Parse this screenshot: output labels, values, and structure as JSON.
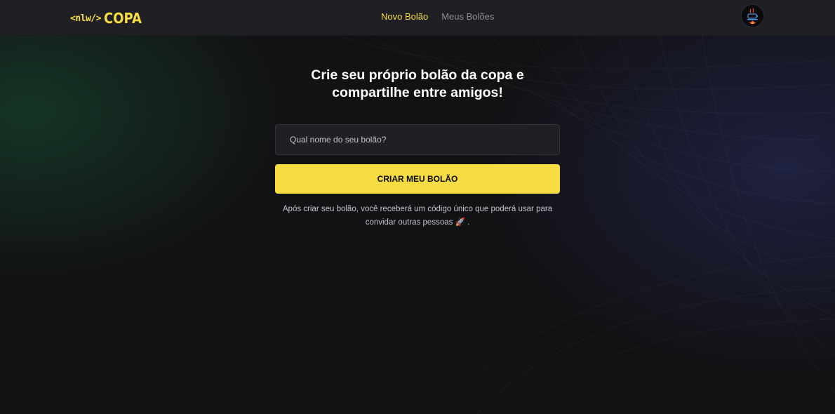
{
  "header": {
    "logo_prefix": "<nlw/>",
    "logo_main": "COPA",
    "nav": [
      {
        "label": "Novo Bolão",
        "active": true
      },
      {
        "label": "Meus Bolões",
        "active": false
      }
    ],
    "avatar_icon": "java-cup-icon"
  },
  "main": {
    "title": "Crie seu próprio bolão da copa e compartilhe entre amigos!",
    "input_placeholder": "Qual nome do seu bolão?",
    "input_value": "",
    "button_label": "CRIAR MEU BOLÃO",
    "helper_text": "Após criar seu bolão, você receberá um código único que poderá usar para convidar outras pessoas",
    "helper_emoji": "🚀",
    "helper_suffix": "."
  },
  "colors": {
    "accent": "#F7DD43",
    "background": "#121214",
    "header_bg": "#202024",
    "input_bg": "#202024",
    "muted_text": "#8D8D99"
  }
}
